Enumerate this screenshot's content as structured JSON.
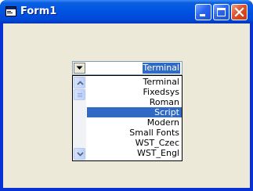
{
  "window": {
    "title": "Form1",
    "icon": "app-window-icon",
    "controls": {
      "minimize_icon": "minimize-icon",
      "maximize_icon": "maximize-icon",
      "close_icon": "close-icon"
    }
  },
  "combo": {
    "value": "Terminal",
    "dropdown_icon": "chevron-down-icon",
    "items": [
      {
        "label": "Terminal",
        "selected": false
      },
      {
        "label": "Fixedsys",
        "selected": false
      },
      {
        "label": "Roman",
        "selected": false
      },
      {
        "label": "Script",
        "selected": true
      },
      {
        "label": "Modern",
        "selected": false
      },
      {
        "label": "Small Fonts",
        "selected": false
      },
      {
        "label": "WST_Czec",
        "selected": false
      },
      {
        "label": "WST_Engl",
        "selected": false
      }
    ]
  },
  "colors": {
    "title_bar": "#0054e3",
    "client_background": "#ece9d8",
    "selection": "#316ac5"
  }
}
